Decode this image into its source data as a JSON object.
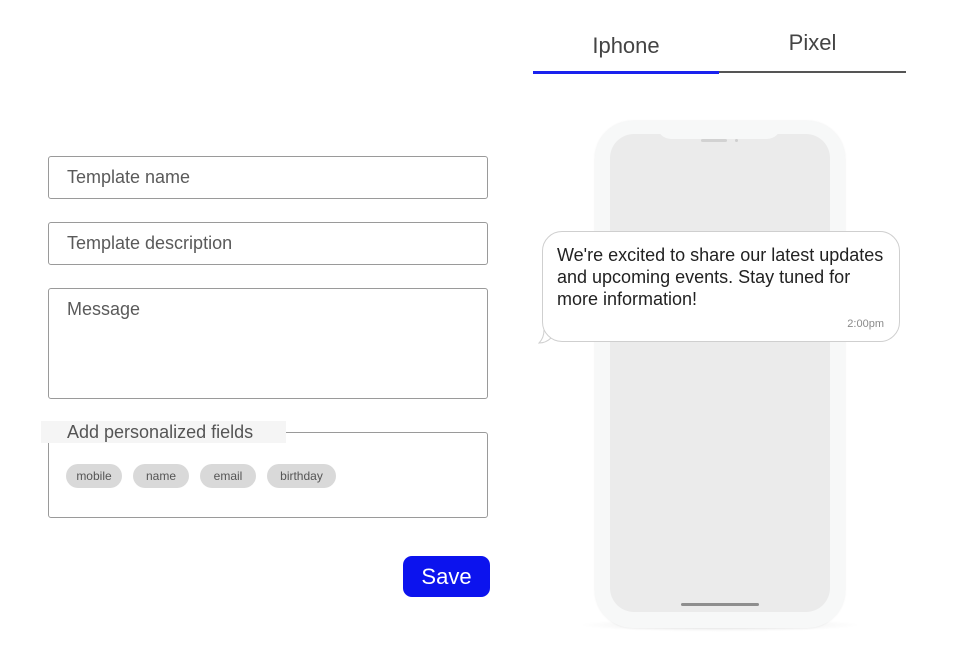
{
  "tabs": [
    {
      "label": "Iphone",
      "active": true
    },
    {
      "label": "Pixel",
      "active": false
    }
  ],
  "form": {
    "template_name": {
      "value": "",
      "placeholder": "Template name"
    },
    "template_description": {
      "value": "",
      "placeholder": "Template description"
    },
    "message": {
      "value": "",
      "placeholder": "Message"
    },
    "personalized_fields": {
      "legend": "Add personalized fields",
      "chips": [
        "mobile",
        "name",
        "email",
        "birthday"
      ]
    },
    "save_label": "Save"
  },
  "preview": {
    "message_text": "We're excited to share our latest updates and upcoming events. Stay tuned for more information!",
    "time": "2:00pm"
  },
  "colors": {
    "accent": "#0c13ee",
    "tab_active_underline": "#1a22ee"
  }
}
